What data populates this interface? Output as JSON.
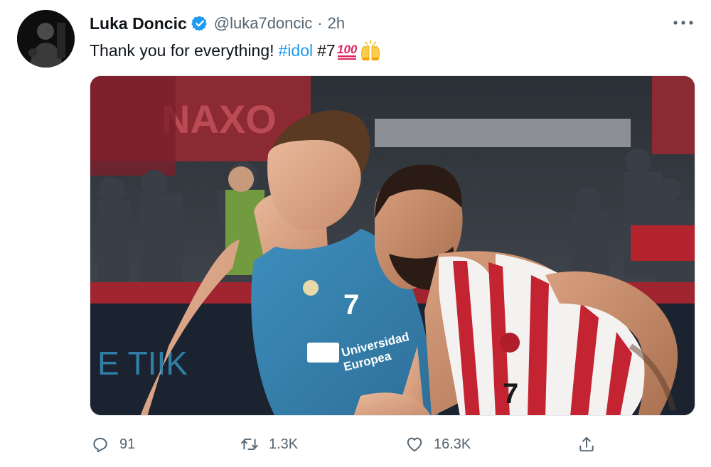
{
  "author": {
    "name": "Luka Doncic",
    "handle": "@luka7doncic",
    "separator": "·",
    "time": "2h",
    "verified": true,
    "avatar_icon": "avatar-photo"
  },
  "tweet": {
    "text_plain": "Thank you for everything!",
    "hashtag": "#idol",
    "text_after": "#7",
    "emojis": [
      "hundred-points-emoji",
      "raising-hands-emoji"
    ],
    "media": {
      "description_icon": "basketball-photo",
      "jersey_number_left": "7",
      "jersey_sponsor": "Universidad Europea",
      "jersey_number_right": "7"
    }
  },
  "more_menu": {
    "icon": "more-dots-icon"
  },
  "actions": {
    "reply_count": "91",
    "retweet_count": "1.3K",
    "like_count": "16.3K",
    "share_icon": "share-icon"
  },
  "colors": {
    "link": "#1d9bf0",
    "verified": "#1d9bf0",
    "secondary_text": "#536471",
    "primary_text": "#0f1419"
  }
}
